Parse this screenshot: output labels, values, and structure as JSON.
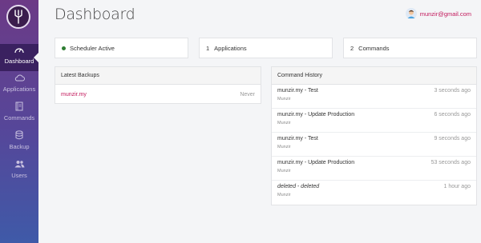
{
  "sidebar": {
    "items": [
      {
        "label": "Dashboard",
        "icon": "gauge-icon"
      },
      {
        "label": "Applications",
        "icon": "cloud-icon"
      },
      {
        "label": "Commands",
        "icon": "book-icon"
      },
      {
        "label": "Backup",
        "icon": "database-icon"
      },
      {
        "label": "Users",
        "icon": "users-icon"
      }
    ]
  },
  "header": {
    "title": "Dashboard",
    "user_email": "munzir@gmail.com"
  },
  "stats": {
    "scheduler": "Scheduler Active",
    "applications_count": "1",
    "applications_label": "Applications",
    "commands_count": "2",
    "commands_label": "Commands"
  },
  "backups": {
    "title": "Latest Backups",
    "rows": [
      {
        "name": "munzir.my",
        "when": "Never"
      }
    ]
  },
  "history": {
    "title": "Command History",
    "rows": [
      {
        "title": "munzir.my - Test",
        "user": "Munzir",
        "time": "3 seconds ago"
      },
      {
        "title": "munzir.my - Update Production",
        "user": "Munzir",
        "time": "6 seconds ago"
      },
      {
        "title": "munzir.my - Test",
        "user": "Munzir",
        "time": "9 seconds ago"
      },
      {
        "title": "munzir.my - Update Production",
        "user": "Munzir",
        "time": "53 seconds ago"
      },
      {
        "title": "deleted - deleted",
        "user": "Munzir",
        "time": "1 hour ago"
      }
    ]
  },
  "colors": {
    "accent": "#c2185b",
    "active_status": "#2e7d32",
    "sidebar_top": "#6c3a86",
    "sidebar_bottom": "#3f5aa8"
  }
}
